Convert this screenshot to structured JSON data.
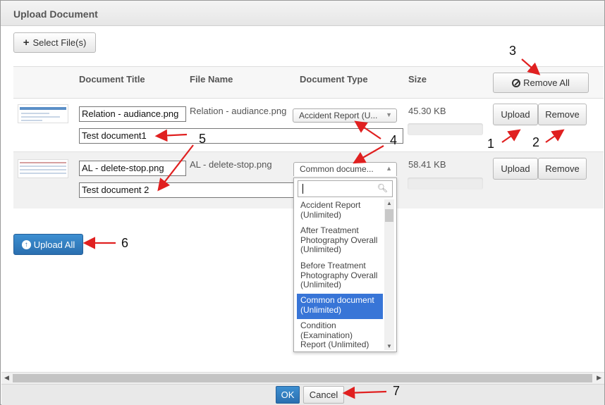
{
  "dialog": {
    "title": "Upload Document"
  },
  "toolbar": {
    "select_files_label": "Select File(s)",
    "select_files_icon": "plus-icon"
  },
  "table": {
    "headers": {
      "document_title": "Document Title",
      "file_name": "File Name",
      "document_type": "Document Type",
      "size": "Size"
    },
    "remove_all_label": "Remove All",
    "rows": [
      {
        "title_value": "Relation - audiance.png",
        "description_value": "Test document1",
        "file_name": "Relation - audiance.png",
        "document_type": "Accident Report (U...",
        "size": "45.30 KB",
        "upload_label": "Upload",
        "remove_label": "Remove",
        "progress": 0
      },
      {
        "title_value": "AL - delete-stop.png",
        "description_value": "Test document 2",
        "file_name": "AL - delete-stop.png",
        "document_type": "Common docume...",
        "size": "58.41 KB",
        "upload_label": "Upload",
        "remove_label": "Remove",
        "progress": 0
      }
    ]
  },
  "dropdown": {
    "search_value": "",
    "options": [
      {
        "label": "Accident Report (Unlimited)",
        "selected": false
      },
      {
        "label": "After Treatment Photography Overall (Unlimited)",
        "selected": false
      },
      {
        "label": "Before Treatment Photography Overall (Unlimited)",
        "selected": false
      },
      {
        "label": "Common document (Unlimited)",
        "selected": true
      },
      {
        "label": "Condition (Examination) Report (Unlimited)",
        "selected": false
      }
    ]
  },
  "upload_all_label": "Upload All",
  "footer": {
    "ok_label": "OK",
    "cancel_label": "Cancel"
  },
  "annotations": {
    "n1": "1",
    "n2": "2",
    "n3": "3",
    "n4": "4",
    "n5": "5",
    "n6": "6",
    "n7": "7"
  },
  "colors": {
    "primary": "#2a6fb0",
    "selected_option": "#3875d7",
    "arrow": "#e02020"
  }
}
